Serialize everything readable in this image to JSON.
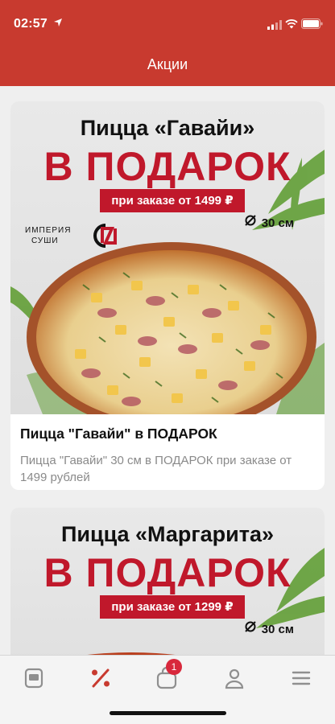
{
  "status_bar": {
    "time": "02:57"
  },
  "header": {
    "title": "Акции"
  },
  "promos": [
    {
      "banner": {
        "headline": "Пицца «Гавайи»",
        "gift": "В ПОДАРОК",
        "condition": "при заказе от 1499 ₽",
        "size": "30 см",
        "brand_lines": [
          "ИМПЕРИЯ",
          "СУШИ"
        ]
      },
      "title": "Пицца \"Гавайи\" в ПОДАРОК",
      "description": "Пицца \"Гавайи\" 30 см в ПОДАРОК при заказе от 1499 рублей"
    },
    {
      "banner": {
        "headline": "Пицца «Маргарита»",
        "gift": "В ПОДАРОК",
        "condition": "при заказе от 1299 ₽",
        "size": "30 см"
      }
    }
  ],
  "tabbar": {
    "active": "promotions",
    "cart_badge": "1",
    "items": [
      "menu-icon",
      "percent-icon",
      "cart-icon",
      "profile-icon",
      "hamburger-icon"
    ]
  },
  "colors": {
    "brand_red": "#c83a2f",
    "promo_red": "#c0182b",
    "badge_red": "#d8283c"
  }
}
